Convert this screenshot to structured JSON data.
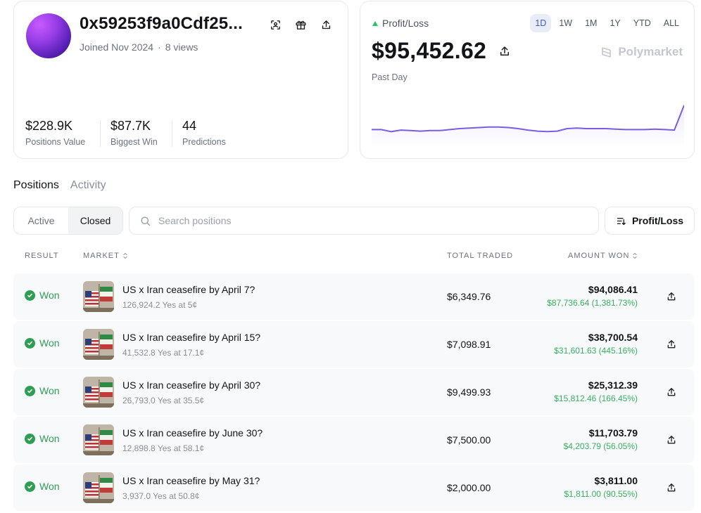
{
  "profile": {
    "username": "0x59253f9a0Cdf25...",
    "joined": "Joined Nov 2024",
    "dot": "·",
    "views": "8 views",
    "icons": [
      "scan-icon",
      "gift-icon",
      "share-icon"
    ],
    "stats": [
      {
        "value": "$228.9K",
        "label": "Positions Value"
      },
      {
        "value": "$87.7K",
        "label": "Biggest Win"
      },
      {
        "value": "44",
        "label": "Predictions"
      }
    ]
  },
  "pnl": {
    "label": "Profit/Loss",
    "value": "$95,452.62",
    "period": "Past Day",
    "brand": "Polymarket",
    "timeframes": [
      "1D",
      "1W",
      "1M",
      "1Y",
      "YTD",
      "ALL"
    ],
    "active_timeframe": "1D",
    "line_color": "#7c5ce0",
    "sparkline": [
      0.3,
      0.3,
      0.26,
      0.29,
      0.28,
      0.27,
      0.28,
      0.28,
      0.3,
      0.32,
      0.33,
      0.34,
      0.35,
      0.35,
      0.34,
      0.32,
      0.29,
      0.27,
      0.26,
      0.27,
      0.32,
      0.33,
      0.32,
      0.32,
      0.32,
      0.31,
      0.3,
      0.3,
      0.3,
      0.31,
      0.3,
      0.29,
      0.78
    ]
  },
  "tabs": [
    {
      "label": "Positions",
      "active": true
    },
    {
      "label": "Activity",
      "active": false
    }
  ],
  "filters": {
    "segments": [
      {
        "label": "Active",
        "active": false
      },
      {
        "label": "Closed",
        "active": true
      }
    ],
    "search_placeholder": "Search positions",
    "sort_label": "Profit/Loss"
  },
  "table": {
    "headers": {
      "result": "RESULT",
      "market": "MARKET",
      "traded": "TOTAL TRADED",
      "won": "AMOUNT WON"
    },
    "rows": [
      {
        "result": "Won",
        "title": "US x Iran ceasefire by April 7?",
        "sub": "126,924.2 Yes at 5¢",
        "traded": "$6,349.76",
        "won": "$94,086.41",
        "gain": "$87,736.64 (1,381.73%)"
      },
      {
        "result": "Won",
        "title": "US x Iran ceasefire by April 15?",
        "sub": "41,532.8 Yes at 17.1¢",
        "traded": "$7,098.91",
        "won": "$38,700.54",
        "gain": "$31,601.63 (445.16%)"
      },
      {
        "result": "Won",
        "title": "US x Iran ceasefire by April 30?",
        "sub": "26,793.0 Yes at 35.5¢",
        "traded": "$9,499.93",
        "won": "$25,312.39",
        "gain": "$15,812.46 (166.45%)"
      },
      {
        "result": "Won",
        "title": "US x Iran ceasefire by June 30?",
        "sub": "12,898.8 Yes at 58.1¢",
        "traded": "$7,500.00",
        "won": "$11,703.79",
        "gain": "$4,203.79 (56.05%)"
      },
      {
        "result": "Won",
        "title": "US x Iran ceasefire by May 31?",
        "sub": "3,937.0 Yes at 50.8¢",
        "traded": "$2,000.00",
        "won": "$3,811.00",
        "gain": "$1,811.00 (90.55%)"
      }
    ]
  }
}
